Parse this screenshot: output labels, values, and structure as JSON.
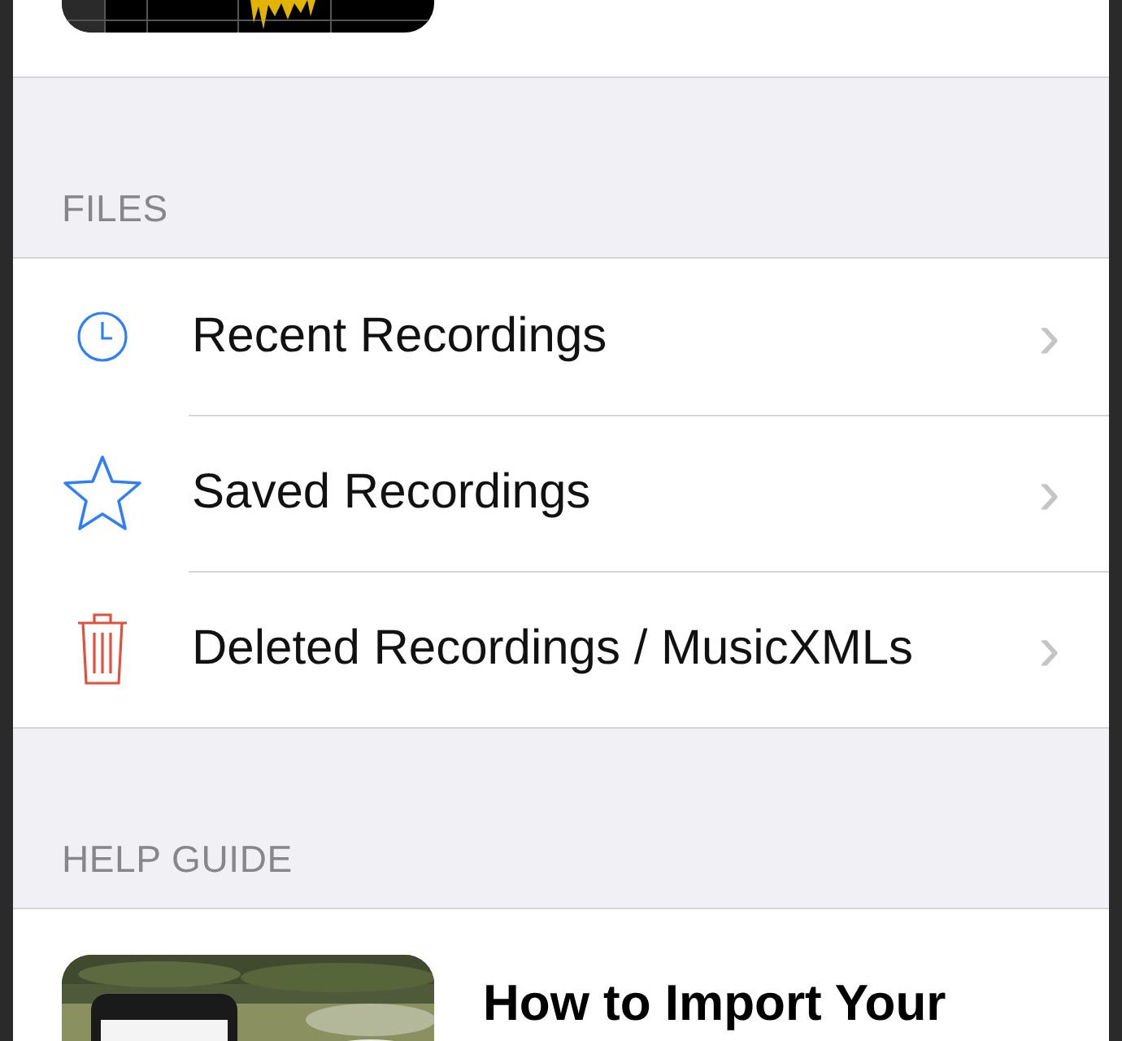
{
  "files": {
    "header": "FILES",
    "items": [
      {
        "kind": "clock",
        "label": "Recent Recordings",
        "chevron": "›"
      },
      {
        "kind": "star",
        "label": "Saved Recordings",
        "chevron": "›"
      },
      {
        "kind": "trash",
        "label": "Deleted Recordings / MusicXMLs",
        "chevron": "›"
      }
    ]
  },
  "help_guide": {
    "header": "HELP GUIDE",
    "items": [
      {
        "kind": "picture",
        "title": "How to Import Your"
      }
    ]
  }
}
